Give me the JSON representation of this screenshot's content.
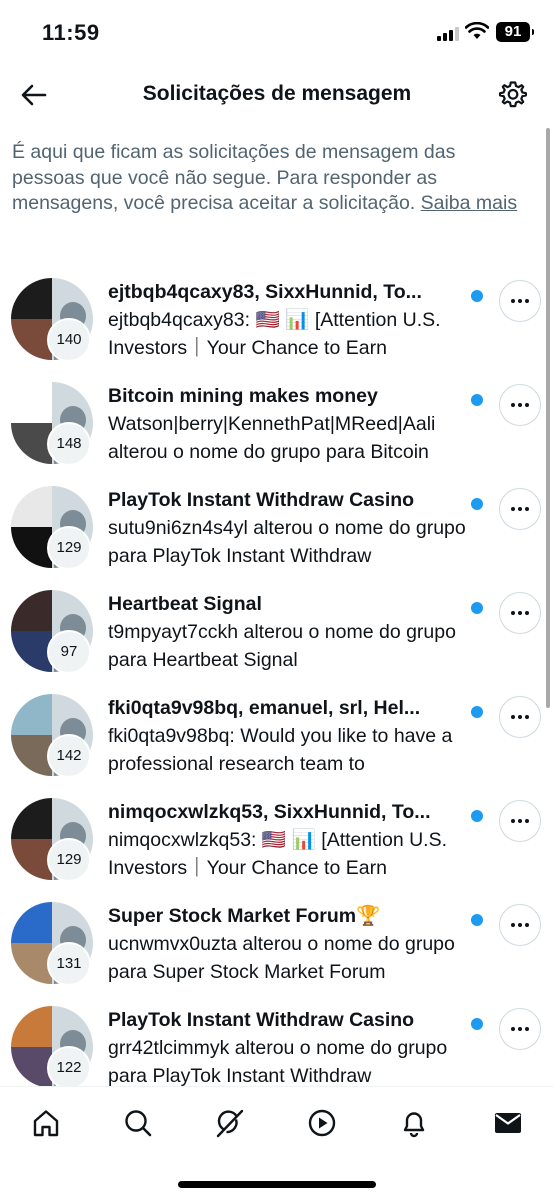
{
  "status_bar": {
    "time": "11:59",
    "battery": "91"
  },
  "header": {
    "title": "Solicitações de mensagem",
    "back_icon": "arrow-left-icon",
    "settings_icon": "gear-icon"
  },
  "info": {
    "text": "É aqui que ficam as solicitações de mensagem das pessoas que você não segue. Para responder as mensagens, você precisa aceitar a solicitação. ",
    "link": "Saiba mais"
  },
  "requests": [
    {
      "title": "ejtbqb4qcaxy83, SixxHunnid, To...",
      "preview": "ejtbqb4qcaxy83: 🇺🇸 📊 [Attention U.S. Investors｜Your Chance to Earn",
      "count": "140",
      "colors": [
        "#1c1c1c",
        "#7a4a3a"
      ]
    },
    {
      "title": "Bitcoin mining makes money",
      "preview": "Watson|berry|KennethPat|MReed|Aali alterou o nome do grupo para Bitcoin",
      "count": "148",
      "colors": [
        "#ffffff",
        "#4a4a4a"
      ]
    },
    {
      "title": "PlayTok Instant Withdraw Casino",
      "preview": "sutu9ni6zn4s4yl alterou o nome do grupo para PlayTok Instant Withdraw",
      "count": "129",
      "colors": [
        "#e8e8e8",
        "#111111"
      ]
    },
    {
      "title": "Heartbeat Signal",
      "preview": "t9mpyayt7cckh alterou o nome do grupo para Heartbeat Signal",
      "count": "97",
      "colors": [
        "#3b2a2a",
        "#2a3b6a"
      ]
    },
    {
      "title": "fki0qta9v98bq, emanuel, srl, Hel...",
      "preview": "fki0qta9v98bq: Would you like to have a professional research team to",
      "count": "142",
      "colors": [
        "#8fb7c8",
        "#7a6a5a"
      ]
    },
    {
      "title": "nimqocxwlzkq53, SixxHunnid, To...",
      "preview": "nimqocxwlzkq53: 🇺🇸 📊 [Attention U.S. Investors｜Your Chance to Earn",
      "count": "129",
      "colors": [
        "#1c1c1c",
        "#7a4a3a"
      ]
    },
    {
      "title": "Super Stock Market Forum🏆",
      "preview": "ucnwmvx0uzta alterou o nome do grupo para Super Stock Market Forum",
      "count": "131",
      "colors": [
        "#2a6ac8",
        "#a88a6a"
      ]
    },
    {
      "title": "PlayTok Instant Withdraw Casino",
      "preview": "grr42tlcimmyk alterou o nome do grupo para PlayTok Instant Withdraw",
      "count": "122",
      "colors": [
        "#c87a3a",
        "#5a4a6a"
      ]
    }
  ],
  "unread_color": "#1d9bf0",
  "tabs": [
    "home-icon",
    "search-icon",
    "grok-icon",
    "play-icon",
    "bell-icon",
    "mail-icon"
  ]
}
